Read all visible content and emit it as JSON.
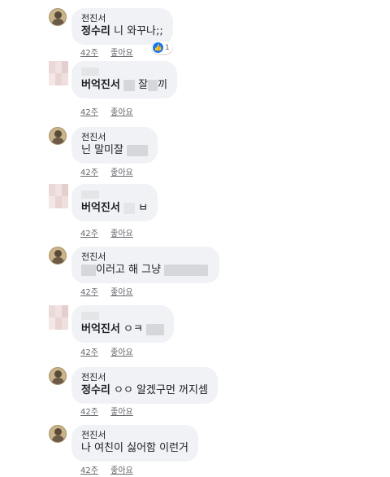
{
  "comments": [
    {
      "author": "전진서",
      "mention": "정수리",
      "text": "니 와꾸나;;",
      "time": "42주",
      "like": "좋아요",
      "reaction_count": "1"
    },
    {
      "author": "",
      "mention": "버억진서",
      "text": "잘",
      "text2": "끼",
      "time": "42주",
      "like": "좋아요"
    },
    {
      "author": "전진서",
      "mention": "",
      "text": "닌 말미잘",
      "time": "42주",
      "like": "좋아요"
    },
    {
      "author": "",
      "mention": "버억진서",
      "text": "ㅂ",
      "time": "42주",
      "like": "좋아요"
    },
    {
      "author": "전진서",
      "mention": "",
      "text": "이러고 해 그냥",
      "time": "42주",
      "like": "좋아요"
    },
    {
      "author": "",
      "mention": "버억진서",
      "text": "ㅇㅋ",
      "time": "42주",
      "like": "좋아요"
    },
    {
      "author": "전진서",
      "mention": "정수리",
      "text": "ㅇㅇ 알겠구먼 꺼지셈",
      "time": "42주",
      "like": "좋아요"
    },
    {
      "author": "전진서",
      "mention": "",
      "text": "나 여친이 싫어함 이런거",
      "time": "42주",
      "like": "좋아요"
    }
  ],
  "colors": {
    "bubble": "#f0f2f5",
    "like_blue": "#1877f2",
    "meta": "#65676b"
  }
}
